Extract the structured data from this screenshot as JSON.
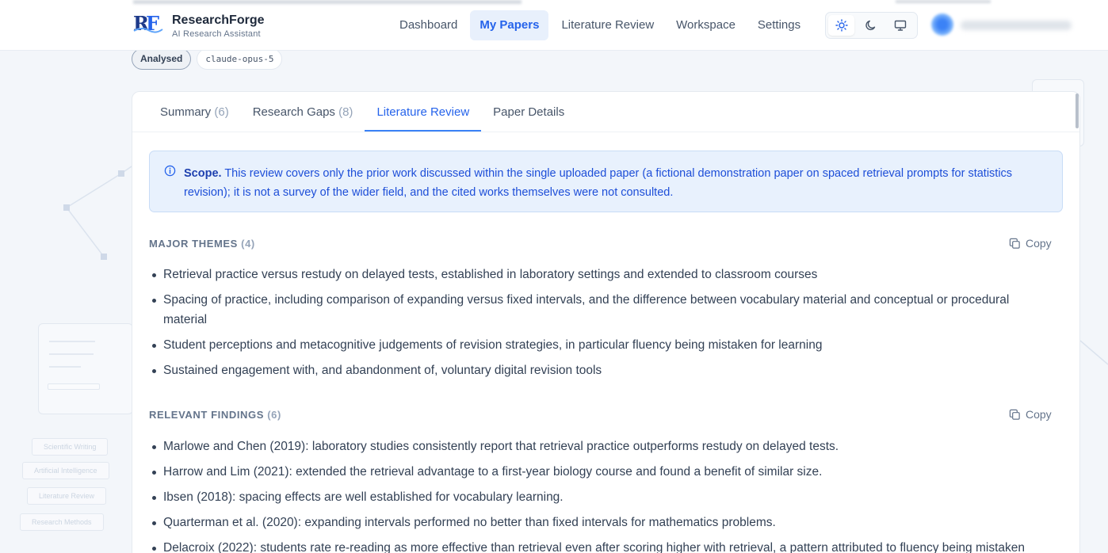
{
  "app": {
    "brand_name": "ResearchForge",
    "brand_sub": "AI Research Assistant"
  },
  "nav": {
    "items": [
      {
        "label": "Dashboard"
      },
      {
        "label": "My Papers"
      },
      {
        "label": "Literature Review"
      },
      {
        "label": "Workspace"
      },
      {
        "label": "Settings"
      }
    ],
    "active": "My Papers"
  },
  "theme": {
    "options": [
      "light-icon",
      "moon-icon",
      "monitor-icon"
    ],
    "active": "light"
  },
  "badges": {
    "status": "Analysed",
    "model": "claude-opus-5"
  },
  "tabs": [
    {
      "label": "Summary",
      "count": "(6)"
    },
    {
      "label": "Research Gaps",
      "count": "(8)"
    },
    {
      "label": "Literature Review",
      "count": ""
    },
    {
      "label": "Paper Details",
      "count": ""
    }
  ],
  "scope": {
    "lead": "Scope.",
    "text": " This review covers only the prior work discussed within the single uploaded paper (a fictional demonstration paper on spaced retrieval prompts for statistics revision); it is not a survey of the wider field, and the cited works themselves were not consulted."
  },
  "major_themes": {
    "title": "MAJOR THEMES",
    "count": "(4)",
    "copy_label": "Copy",
    "items": [
      "Retrieval practice versus restudy on delayed tests, established in laboratory settings and extended to classroom courses",
      "Spacing of practice, including comparison of expanding versus fixed intervals, and the difference between vocabulary material and conceptual or procedural material",
      "Student perceptions and metacognitive judgements of revision strategies, in particular fluency being mistaken for learning",
      "Sustained engagement with, and abandonment of, voluntary digital revision tools"
    ]
  },
  "relevant_findings": {
    "title": "RELEVANT FINDINGS",
    "count": "(6)",
    "copy_label": "Copy",
    "items": [
      "Marlowe and Chen (2019): laboratory studies consistently report that retrieval practice outperforms restudy on delayed tests.",
      "Harrow and Lim (2021): extended the retrieval advantage to a first-year biology course and found a benefit of similar size.",
      "Ibsen (2018): spacing effects are well established for vocabulary learning.",
      "Quarterman et al. (2020): expanding intervals performed no better than fixed intervals for mathematics problems.",
      "Delacroix (2022): students rate re-reading as more effective than retrieval even after scoring higher with retrieval, a pattern attributed to fluency being mistaken"
    ]
  },
  "background_tags": [
    "Scientific Writing",
    "Artificial Intelligence",
    "Literature Review",
    "Research Methods"
  ],
  "colors": {
    "accent": "#2563eb",
    "scope_bg": "#e8f1fd",
    "page_bg": "#f3f6fa"
  }
}
